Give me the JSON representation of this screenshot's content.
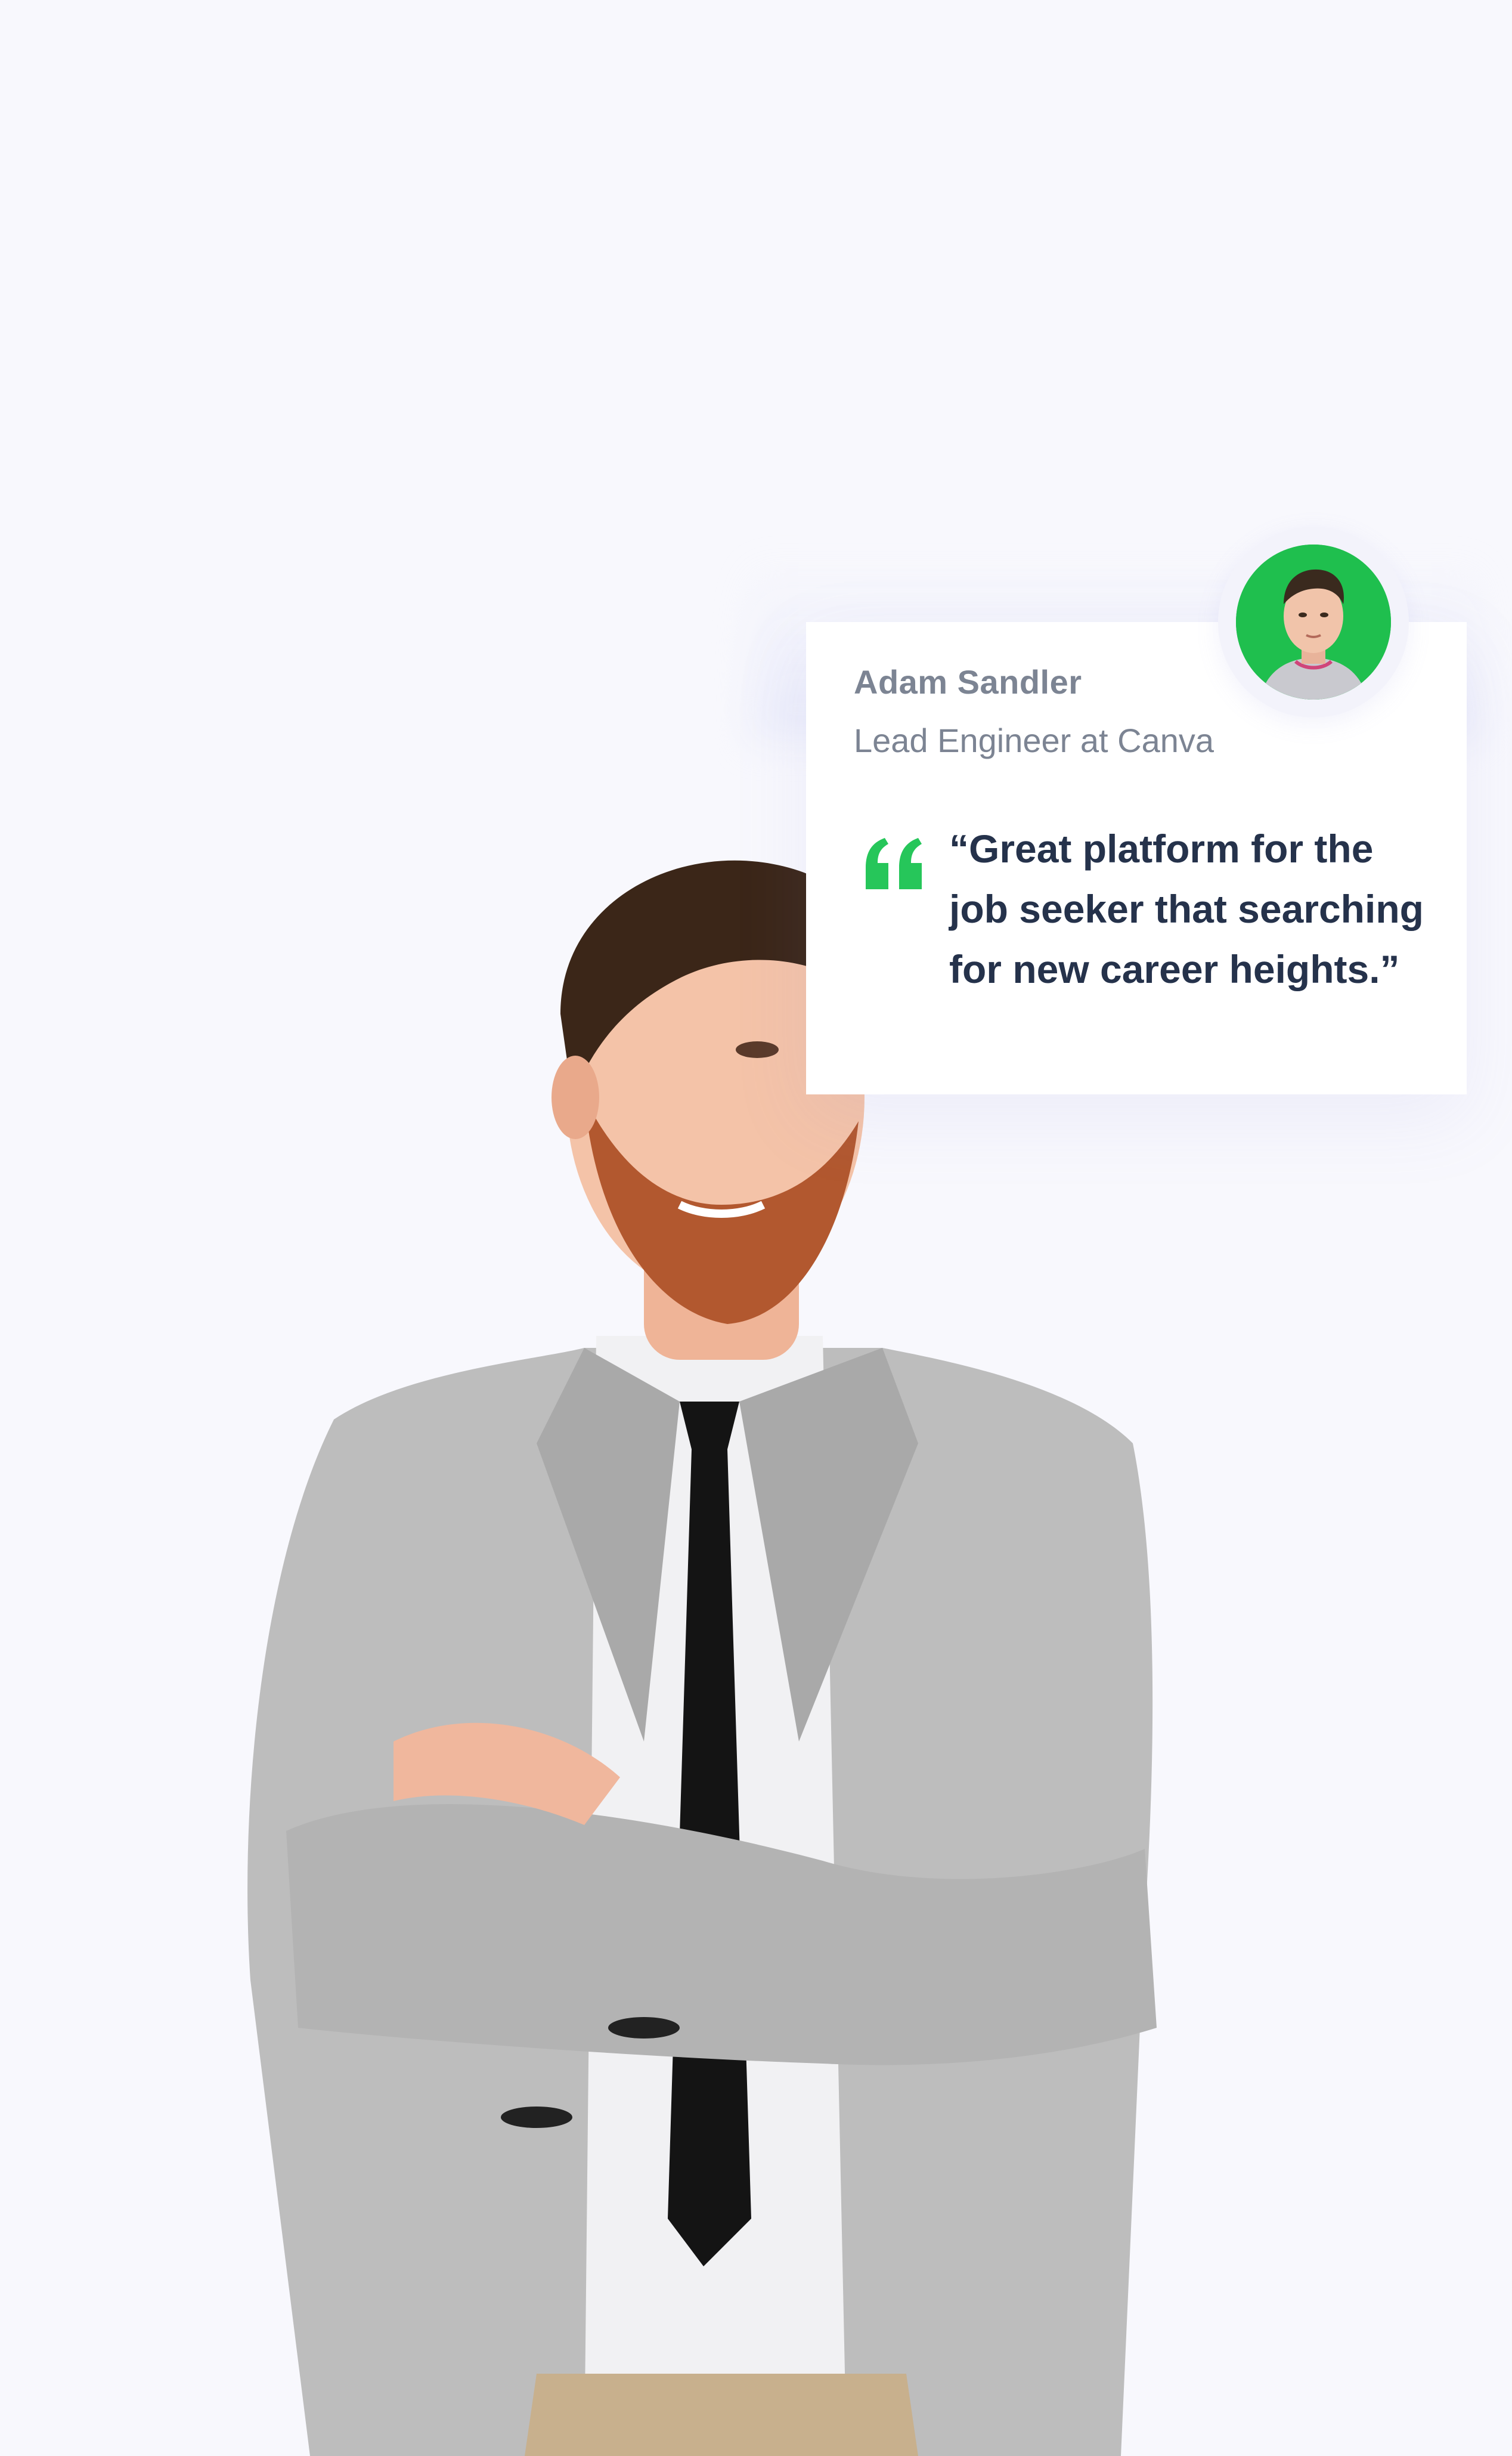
{
  "testimonial": {
    "author_name": "Adam Sandler",
    "author_role": "Lead Engineer at Canva",
    "quote": "“Great platform for the job seeker that searching for new career heights.”",
    "quote_icon": "quote-icon",
    "avatar_icon": "avatar"
  },
  "colors": {
    "background": "#f8f8fd",
    "card": "#ffffff",
    "accent_green": "#26c65a",
    "avatar_bg": "#1fbf4e",
    "text_dark": "#25324b",
    "text_muted": "#7c8493"
  }
}
